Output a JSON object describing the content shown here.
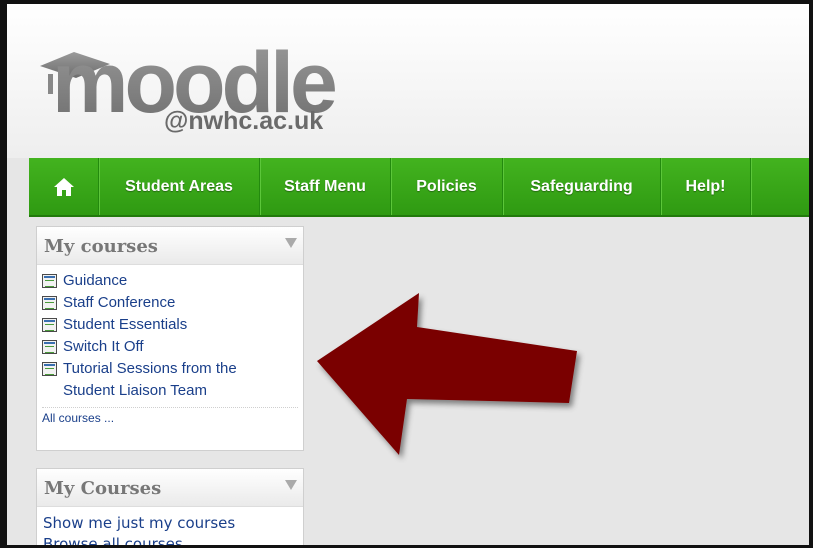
{
  "logo": {
    "wordmark": "moodle",
    "subtext": "@nwhc.ac.uk"
  },
  "nav": {
    "home_icon": "home-icon",
    "items": [
      {
        "label": "Student Areas"
      },
      {
        "label": "Staff Menu"
      },
      {
        "label": "Policies"
      },
      {
        "label": "Safeguarding"
      },
      {
        "label": "Help!"
      }
    ]
  },
  "my_courses_block": {
    "title": "My courses",
    "courses": [
      {
        "label": "Guidance"
      },
      {
        "label": "Staff Conference"
      },
      {
        "label": "Student Essentials"
      },
      {
        "label": "Switch It Off"
      },
      {
        "label": "Tutorial Sessions from the Student Liaison Team"
      }
    ],
    "all_courses": "All courses ..."
  },
  "my_courses_block2": {
    "title": "My Courses",
    "links": [
      {
        "label": "Show me just my courses"
      },
      {
        "label": "Browse all courses"
      }
    ]
  },
  "colors": {
    "nav_green": "#3aa81b",
    "arrow": "#7a0000",
    "link": "#1a3f8a"
  }
}
